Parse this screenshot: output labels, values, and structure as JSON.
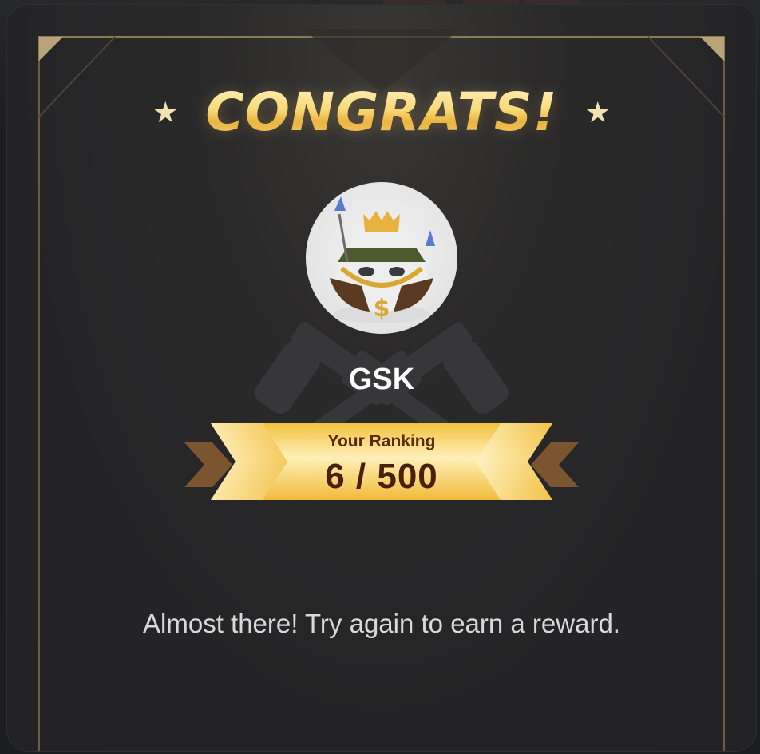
{
  "modal": {
    "title": "CONGRATS!",
    "star_left": "★",
    "star_right": "★",
    "background_emblem": "crossed-revolvers",
    "user": {
      "name": "GSK",
      "avatar": "crowned-bird-avatar"
    },
    "ranking": {
      "label": "Your Ranking",
      "value": "6 / 500"
    },
    "message": "Almost there! Try again to earn a reward."
  },
  "colors": {
    "modal_background": "#242426",
    "gold": "#f4c64a",
    "gold_light": "#fff2c0",
    "ranking_text": "#4a1f0b",
    "chevron_brown": "#7b5530",
    "message_text": "#d9d9d9"
  }
}
